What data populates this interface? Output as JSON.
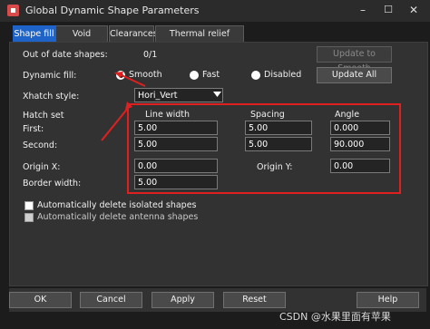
{
  "window": {
    "title": "Global Dynamic Shape Parameters",
    "controls": [
      "–",
      "☐",
      "✕"
    ]
  },
  "tabs": [
    {
      "label": "Shape fill",
      "active": true
    },
    {
      "label": "Void controls"
    },
    {
      "label": "Clearances"
    },
    {
      "label": "Thermal relief connects"
    }
  ],
  "shape_fill": {
    "out_of_date_label": "Out of date shapes:",
    "out_of_date_value": "0/1",
    "update_to_smooth": "Update to Smooth",
    "dynamic_fill_label": "Dynamic fill:",
    "options": {
      "smooth": "Smooth",
      "fast": "Fast",
      "disabled": "Disabled"
    },
    "selected": "Smooth",
    "update_all": "Update All",
    "xhatch_label": "Xhatch style:",
    "xhatch_value": "Hori_Vert",
    "hatch_set_label": "Hatch set",
    "col_line_width": "Line width",
    "col_spacing": "Spacing",
    "col_angle": "Angle",
    "first_label": "First:",
    "first": {
      "line_width": "5.00",
      "spacing": "5.00",
      "angle": "0.000"
    },
    "second_label": "Second:",
    "second": {
      "line_width": "5.00",
      "spacing": "5.00",
      "angle": "90.000"
    },
    "origin_x_label": "Origin X:",
    "origin_x": "0.00",
    "origin_y_label": "Origin Y:",
    "origin_y": "0.00",
    "border_width_label": "Border width:",
    "border_width": "5.00",
    "auto_delete_isolated": "Automatically delete isolated shapes",
    "auto_delete_antenna": "Automatically delete antenna shapes"
  },
  "footer": {
    "ok": "OK",
    "cancel": "Cancel",
    "apply": "Apply",
    "reset": "Reset",
    "help": "Help"
  },
  "watermark": "CSDN @水果里面有苹果",
  "colors": {
    "accent": "#1e64c8",
    "annotation": "#e02020"
  }
}
